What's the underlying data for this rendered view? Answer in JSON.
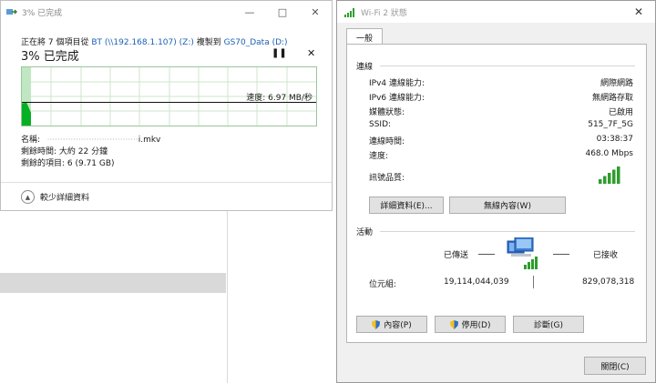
{
  "copy_window": {
    "title": "3% 已完成",
    "line_prefix": "正在將 7 個項目從 ",
    "source": "BT (\\\\192.168.1.107) (Z:)",
    "line_mid": " 複製到 ",
    "destination": "GS70_Data (D:)",
    "percent": "3% 已完成",
    "progress_fraction": 0.03,
    "speed": "速度: 6.97 MB/秒",
    "name_label": "名稱:",
    "name_value": "i.mkv",
    "time_left": "剩餘時間: 大約 22 分鐘",
    "items_left": "剩餘的項目: 6 (9.71 GB)",
    "less_details": "較少詳細資料"
  },
  "wifi_window": {
    "title": "Wi-Fi 2 狀態",
    "tab_general": "一般",
    "connection_header": "連線",
    "rows": [
      {
        "label": "IPv4 連線能力:",
        "value": "網際網路"
      },
      {
        "label": "IPv6 連線能力:",
        "value": "無網路存取"
      },
      {
        "label": "媒體狀態:",
        "value": "已啟用"
      },
      {
        "label": "SSID:",
        "value": "515_7F_5G"
      },
      {
        "label": "連線時間:",
        "value": "03:38:37"
      },
      {
        "label": "速度:",
        "value": "468.0 Mbps"
      }
    ],
    "signal_label": "訊號品質:",
    "signal_bars": 5,
    "details_button": "詳細資料(E)...",
    "wireless_props_button": "無線內容(W)",
    "activity_header": "活動",
    "sent_label": "已傳送",
    "received_label": "已接收",
    "bytes_label": "位元組:",
    "bytes_sent": "19,114,044,039",
    "bytes_received": "829,078,318",
    "properties_button": "內容(P)",
    "disable_button": "停用(D)",
    "diagnose_button": "診斷(G)",
    "close_button": "關閉(C)"
  },
  "colors": {
    "link": "#1a5fb4",
    "graph_fill": "#06b025",
    "graph_grid": "#cfe6cf",
    "signal": "#2e9d2e"
  }
}
